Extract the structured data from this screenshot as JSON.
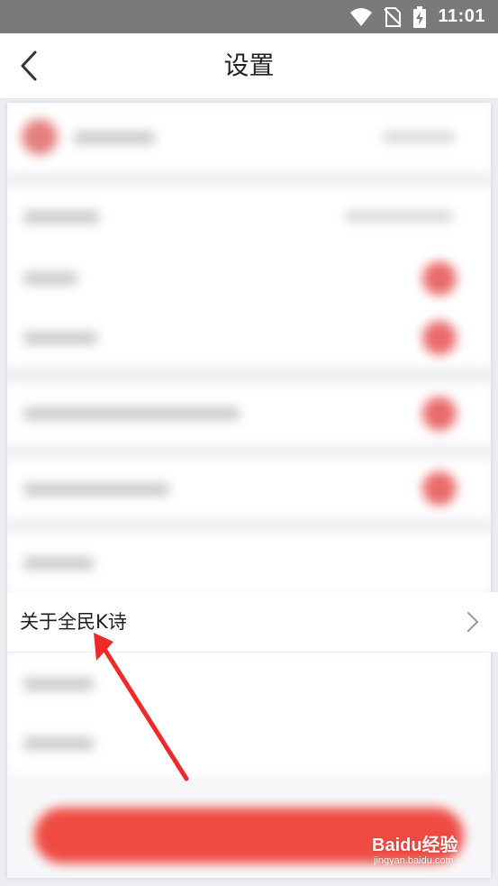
{
  "status_bar": {
    "time": "11:01",
    "icons": [
      "wifi-icon",
      "no-sim-icon",
      "battery-charging-icon"
    ]
  },
  "header": {
    "title": "设置",
    "back_icon": "chevron-left-icon"
  },
  "highlighted_row": {
    "label": "关于全民K诗",
    "icon": "chevron-right-icon"
  },
  "annotation": {
    "color": "#ee2a2a"
  },
  "watermark": {
    "brand": "Baidu经验",
    "url": "jingyan.baidu.com"
  },
  "colors": {
    "accent": "#ef4b42",
    "status_bar": "#7a7a7a"
  }
}
